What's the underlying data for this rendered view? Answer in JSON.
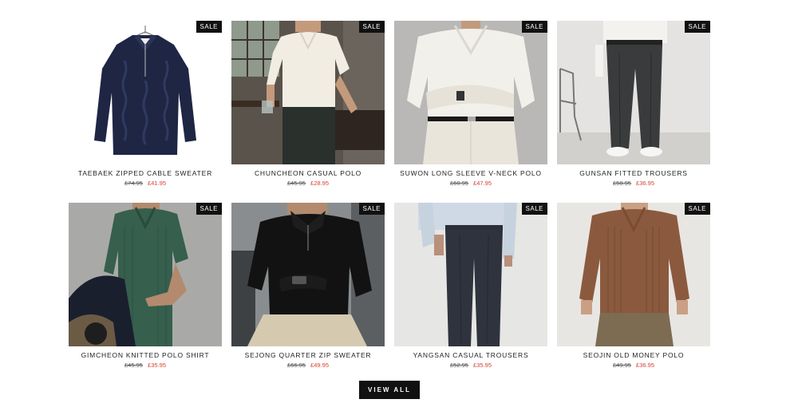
{
  "products": [
    {
      "title": "TAEBAEK ZIPPED CABLE SWEATER",
      "old_price": "£74.95",
      "sale_price": "£41.95",
      "badge": "SALE"
    },
    {
      "title": "CHUNCHEON CASUAL POLO",
      "old_price": "£45.95",
      "sale_price": "£28.95",
      "badge": "SALE"
    },
    {
      "title": "SUWON LONG SLEEVE V-NECK POLO",
      "old_price": "£60.95",
      "sale_price": "£47.95",
      "badge": "SALE"
    },
    {
      "title": "GUNSAN FITTED TROUSERS",
      "old_price": "£58.95",
      "sale_price": "£36.95",
      "badge": "SALE"
    },
    {
      "title": "GIMCHEON KNITTED POLO SHIRT",
      "old_price": "£45.95",
      "sale_price": "£35.95",
      "badge": "SALE"
    },
    {
      "title": "SEJONG QUARTER ZIP SWEATER",
      "old_price": "£66.95",
      "sale_price": "£49.95",
      "badge": "SALE"
    },
    {
      "title": "YANGSAN CASUAL TROUSERS",
      "old_price": "£52.95",
      "sale_price": "£35.95",
      "badge": "SALE"
    },
    {
      "title": "SEOJIN OLD MONEY POLO",
      "old_price": "£49.95",
      "sale_price": "£36.95",
      "badge": "SALE"
    }
  ],
  "view_all_label": "VIEW ALL",
  "colors": {
    "sale_price": "#d6402f",
    "badge_bg": "#111111",
    "button_bg": "#111111"
  }
}
